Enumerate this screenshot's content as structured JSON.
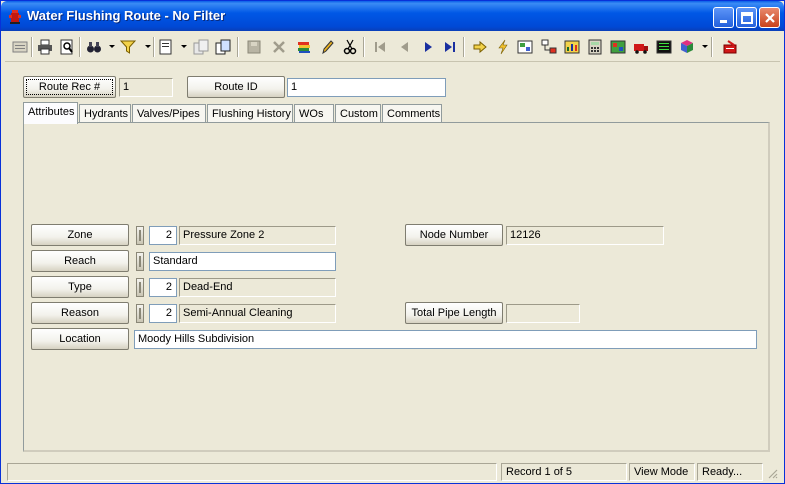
{
  "window": {
    "title": "Water Flushing Route - No Filter"
  },
  "toolbar": {
    "icons": [
      "list-icon",
      "print-icon",
      "print-preview-icon",
      "binoculars-icon",
      "filter-icon",
      "new-record-icon",
      "copy-icon",
      "duplicate-icon",
      "save-icon",
      "delete-icon",
      "stack-icon",
      "edit-pencil-icon",
      "cut-icon",
      "first-record-icon",
      "previous-record-icon",
      "next-record-icon",
      "last-record-icon",
      "go-arrow-icon",
      "lightning-icon",
      "map-icon",
      "hierarchy-icon",
      "chart-icon",
      "calculator-icon",
      "grid-icon",
      "truck-icon",
      "report-icon",
      "book-icon",
      "exit-icon"
    ]
  },
  "header": {
    "route_rec_label": "Route Rec #",
    "route_rec_value": "1",
    "route_id_label": "Route ID",
    "route_id_value": "1"
  },
  "tabs": [
    {
      "label": "Attributes"
    },
    {
      "label": "Hydrants"
    },
    {
      "label": "Valves/Pipes"
    },
    {
      "label": "Flushing History"
    },
    {
      "label": "WOs"
    },
    {
      "label": "Custom"
    },
    {
      "label": "Comments"
    }
  ],
  "attributes": {
    "zone_label": "Zone",
    "zone_code": "2",
    "zone_desc": "Pressure Zone 2",
    "reach_label": "Reach",
    "reach_value": "Standard",
    "type_label": "Type",
    "type_code": "2",
    "type_desc": "Dead-End",
    "reason_label": "Reason",
    "reason_code": "2",
    "reason_desc": "Semi-Annual Cleaning",
    "location_label": "Location",
    "location_value": "Moody Hills Subdivision",
    "node_number_label": "Node Number",
    "node_number_value": "12126",
    "total_pipe_length_label": "Total Pipe Length",
    "total_pipe_length_value": ""
  },
  "status": {
    "blank": "",
    "record": "Record 1 of 5",
    "mode": "View Mode",
    "state": "Ready..."
  },
  "colors": {
    "titlebar": "#0058e6",
    "face": "#ece9d8"
  }
}
